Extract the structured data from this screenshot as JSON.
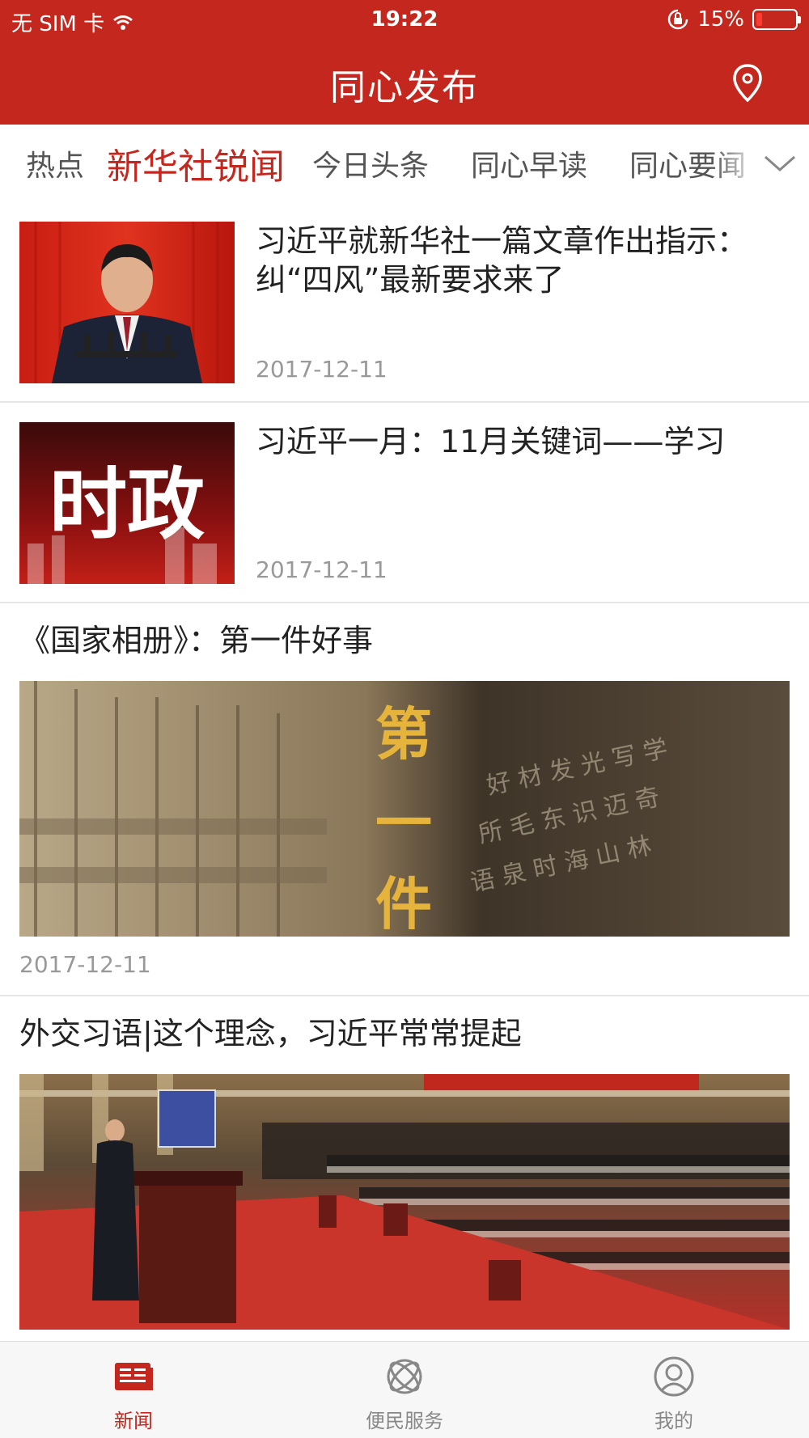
{
  "status_bar": {
    "carrier": "无 SIM 卡",
    "time": "19:22",
    "battery": "15%",
    "battery_level": 0.15
  },
  "header": {
    "title": "同心发布",
    "location_icon": "location-pin-icon"
  },
  "channel_tabs": [
    {
      "label": "热点",
      "active": false
    },
    {
      "label": "新华社锐闻",
      "active": true
    },
    {
      "label": "今日头条",
      "active": false
    },
    {
      "label": "同心早读",
      "active": false
    },
    {
      "label": "同心要闻",
      "active": false
    }
  ],
  "news": [
    {
      "title": "习近平就新华社一篇文章作出指示：纠“四风”最新要求来了",
      "date": "2017-12-11",
      "image": "speaker-at-podium-photo"
    },
    {
      "title": "习近平一月：11月关键词——学习",
      "date": "2017-12-11",
      "image": "shizheng-banner",
      "image_text": "时政"
    },
    {
      "title": "《国家相册》：第一件好事",
      "date": "2017-12-11",
      "image": "printing-type-photo",
      "image_text": "第一件"
    },
    {
      "title": "外交习语|这个理念，习近平常常提起",
      "image": "great-hall-congress-photo"
    }
  ],
  "tabbar": [
    {
      "label": "新闻",
      "icon": "newspaper-icon",
      "active": true
    },
    {
      "label": "便民服务",
      "icon": "services-orbit-icon",
      "active": false
    },
    {
      "label": "我的",
      "icon": "user-profile-icon",
      "active": false
    }
  ],
  "colors": {
    "brand": "#c4271d",
    "text": "#222222",
    "muted": "#999999"
  }
}
